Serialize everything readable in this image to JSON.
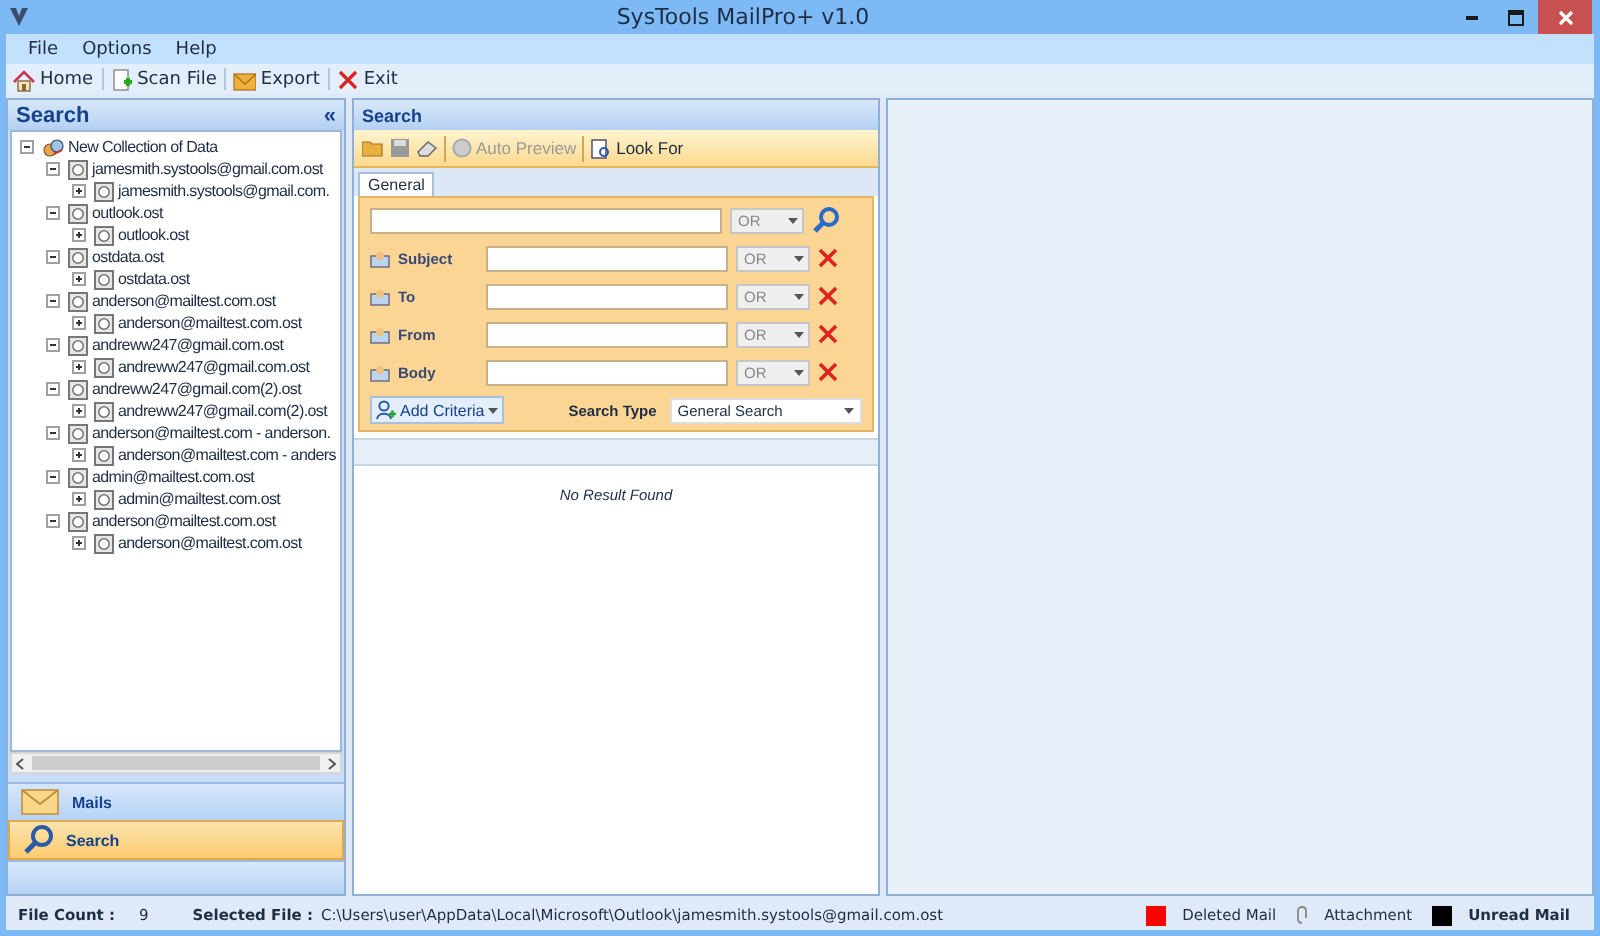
{
  "window": {
    "title": "SysTools MailPro+ v1.0"
  },
  "menu": [
    "File",
    "Options",
    "Help"
  ],
  "toolbar": [
    {
      "kind": "home",
      "label": "Home"
    },
    {
      "kind": "scan",
      "label": "Scan File"
    },
    {
      "kind": "export",
      "label": "Export"
    },
    {
      "kind": "exit",
      "label": "Exit"
    }
  ],
  "left_panel": {
    "title": "Search",
    "collapse": "«",
    "tree": [
      {
        "label": "New Collection of Data",
        "kind": "collection",
        "expanded": true,
        "children": [
          {
            "label": "jamesmith.systools@gmail.com.ost",
            "expanded": true,
            "children": [
              {
                "label": "jamesmith.systools@gmail.com.",
                "expanded": false
              }
            ]
          },
          {
            "label": "outlook.ost",
            "expanded": true,
            "children": [
              {
                "label": "outlook.ost",
                "expanded": false
              }
            ]
          },
          {
            "label": "ostdata.ost",
            "expanded": true,
            "children": [
              {
                "label": "ostdata.ost",
                "expanded": false
              }
            ]
          },
          {
            "label": "anderson@mailtest.com.ost",
            "expanded": true,
            "children": [
              {
                "label": "anderson@mailtest.com.ost",
                "expanded": false
              }
            ]
          },
          {
            "label": "andreww247@gmail.com.ost",
            "expanded": true,
            "children": [
              {
                "label": "andreww247@gmail.com.ost",
                "expanded": false
              }
            ]
          },
          {
            "label": "andreww247@gmail.com(2).ost",
            "expanded": true,
            "children": [
              {
                "label": "andreww247@gmail.com(2).ost",
                "expanded": false
              }
            ]
          },
          {
            "label": "anderson@mailtest.com - anderson.",
            "expanded": true,
            "children": [
              {
                "label": "anderson@mailtest.com - anders",
                "expanded": false
              }
            ]
          },
          {
            "label": "admin@mailtest.com.ost",
            "expanded": true,
            "children": [
              {
                "label": "admin@mailtest.com.ost",
                "expanded": false
              }
            ]
          },
          {
            "label": "anderson@mailtest.com.ost",
            "expanded": true,
            "children": [
              {
                "label": "anderson@mailtest.com.ost",
                "expanded": false
              }
            ]
          }
        ]
      }
    ],
    "nav": [
      {
        "kind": "mail",
        "label": "Mails",
        "selected": false
      },
      {
        "kind": "search",
        "label": "Search",
        "selected": true
      }
    ]
  },
  "search_panel": {
    "title": "Search",
    "actions": [
      {
        "label": "Auto Preview",
        "disabled": true
      },
      {
        "label": "Look For",
        "disabled": false
      }
    ],
    "tabs": [
      {
        "label": "General",
        "selected": true
      }
    ],
    "main_operator": "OR",
    "criteria": [
      {
        "label": "Subject",
        "operator": "OR"
      },
      {
        "label": "To",
        "operator": "OR"
      },
      {
        "label": "From",
        "operator": "OR"
      },
      {
        "label": "Body",
        "operator": "OR"
      }
    ],
    "add_criteria": "Add Criteria",
    "search_type_label": "Search Type",
    "search_type": "General Search",
    "result_message": "No Result Found"
  },
  "status_bar": {
    "file_count_label": "File Count :",
    "file_count": "9",
    "selected_file_label": "Selected File :",
    "selected_file": "C:\\Users\\user\\AppData\\Local\\Microsoft\\Outlook\\jamesmith.systools@gmail.com.ost",
    "legend": [
      {
        "kind": "swatch",
        "label": "Deleted Mail",
        "color": "#ff0000",
        "bold": false
      },
      {
        "kind": "clip",
        "label": "Attachment",
        "bold": false
      },
      {
        "kind": "swatch",
        "label": "Unread Mail",
        "color": "#000000",
        "bold": true
      }
    ]
  }
}
